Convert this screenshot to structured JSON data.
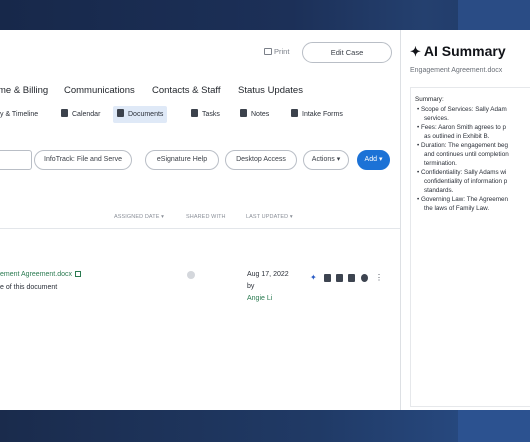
{
  "header": {
    "print_label": "Print",
    "edit_case_label": "Edit Case"
  },
  "main_tabs": [
    "me & Billing",
    "Communications",
    "Contacts & Staff",
    "Status Updates"
  ],
  "sub_tabs": [
    {
      "label": "y & Timeline",
      "active": false
    },
    {
      "label": "Calendar",
      "active": false
    },
    {
      "label": "Documents",
      "active": true
    },
    {
      "label": "Tasks",
      "active": false
    },
    {
      "label": "Notes",
      "active": false
    },
    {
      "label": "Intake Forms",
      "active": false
    }
  ],
  "toolbar": {
    "infotrack_label": "InfoTrack: File and Serve",
    "esignature_label": "eSignature Help",
    "desktop_access_label": "Desktop Access",
    "actions_label": "Actions",
    "add_label": "Add"
  },
  "table": {
    "columns": {
      "assigned_date": "ASSIGNED DATE",
      "shared_with": "SHARED WITH",
      "last_updated": "LAST UPDATED"
    },
    "rows": [
      {
        "name": "ement Agreement.docx",
        "description": "e of this document",
        "date": "Aug 17, 2022",
        "by": "by",
        "user": "Angie Li"
      }
    ]
  },
  "summary": {
    "title": "AI Summary",
    "subtitle": "Engagement Agreement.docx",
    "label": "Summary:",
    "lines": [
      {
        "text": "• Scope of Services: Sally Adam",
        "cont": false
      },
      {
        "text": "services.",
        "cont": true
      },
      {
        "text": "• Fees: Aaron Smith agrees to p",
        "cont": false
      },
      {
        "text": "as outlined in Exhibit B.",
        "cont": true
      },
      {
        "text": "• Duration: The engagement beg",
        "cont": false
      },
      {
        "text": "and continues until completion",
        "cont": true
      },
      {
        "text": "termination.",
        "cont": true
      },
      {
        "text": "• Confidentiality: Sally Adams wi",
        "cont": false
      },
      {
        "text": "confidentiality of information p",
        "cont": true
      },
      {
        "text": "standards.",
        "cont": true
      },
      {
        "text": "• Governing Law: The Agreemen",
        "cont": false
      },
      {
        "text": "the laws of Family Law.",
        "cont": true
      }
    ]
  },
  "colors": {
    "accent": "#1c72d6",
    "link_green": "#2a7a50",
    "active_tab_bg": "#dfe9f7",
    "background_navy": "#1a2c50"
  }
}
